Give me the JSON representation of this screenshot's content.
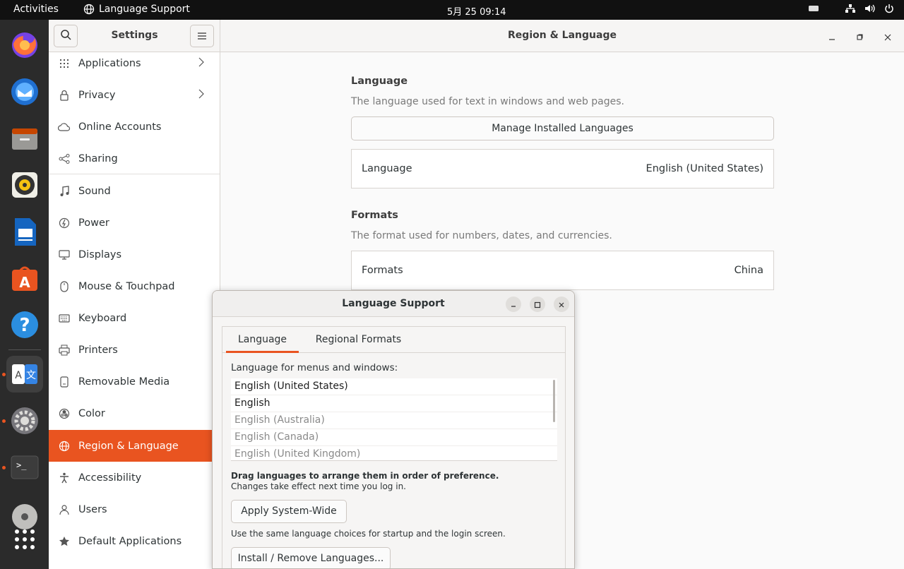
{
  "topbar": {
    "activities": "Activities",
    "app_name": "Language Support",
    "clock": "5月 25  09:14",
    "tray_icons": [
      "keyboard-icon",
      "network-icon",
      "volume-icon",
      "power-icon"
    ]
  },
  "dock": {
    "items": [
      "firefox",
      "thunderbird",
      "files",
      "rhythmbox",
      "libreoffice-writer",
      "ubuntu-software",
      "help",
      "language-support",
      "settings",
      "terminal",
      "disc",
      "show-apps"
    ]
  },
  "sidebar": {
    "title": "Settings",
    "items": [
      {
        "label": "Applications",
        "icon": "apps-grid-icon",
        "chevron": true
      },
      {
        "label": "Privacy",
        "icon": "lock-icon",
        "chevron": true
      },
      {
        "label": "Online Accounts",
        "icon": "cloud-icon",
        "chevron": false
      },
      {
        "label": "Sharing",
        "icon": "share-icon",
        "chevron": false
      },
      {
        "label": "Sound",
        "icon": "music-note-icon",
        "chevron": false
      },
      {
        "label": "Power",
        "icon": "power-icon",
        "chevron": false
      },
      {
        "label": "Displays",
        "icon": "display-icon",
        "chevron": false
      },
      {
        "label": "Mouse & Touchpad",
        "icon": "mouse-icon",
        "chevron": false
      },
      {
        "label": "Keyboard",
        "icon": "keyboard-icon",
        "chevron": false
      },
      {
        "label": "Printers",
        "icon": "printer-icon",
        "chevron": false
      },
      {
        "label": "Removable Media",
        "icon": "media-icon",
        "chevron": false
      },
      {
        "label": "Color",
        "icon": "color-icon",
        "chevron": false
      },
      {
        "label": "Region & Language",
        "icon": "globe-icon",
        "chevron": false,
        "selected": true
      },
      {
        "label": "Accessibility",
        "icon": "accessibility-icon",
        "chevron": false
      },
      {
        "label": "Users",
        "icon": "users-icon",
        "chevron": false
      },
      {
        "label": "Default Applications",
        "icon": "star-icon",
        "chevron": false
      }
    ]
  },
  "main": {
    "title": "Region & Language",
    "language_section": {
      "title": "Language",
      "description": "The language used for text in windows and web pages.",
      "manage_button": "Manage Installed Languages",
      "row_label": "Language",
      "row_value": "English (United States)"
    },
    "formats_section": {
      "title": "Formats",
      "description": "The format used for numbers, dates, and currencies.",
      "row_label": "Formats",
      "row_value": "China"
    }
  },
  "dialog": {
    "title": "Language Support",
    "tabs": [
      "Language",
      "Regional Formats"
    ],
    "active_tab": "Language",
    "menus_label": "Language for menus and windows:",
    "languages": [
      {
        "name": "English (United States)",
        "enabled": true
      },
      {
        "name": "English",
        "enabled": true
      },
      {
        "name": "English (Australia)",
        "enabled": false
      },
      {
        "name": "English (Canada)",
        "enabled": false
      },
      {
        "name": "English (United Kingdom)",
        "enabled": false
      }
    ],
    "drag_hint": "Drag languages to arrange them in order of preference.",
    "effect_hint": "Changes take effect next time you log in.",
    "apply_button": "Apply System-Wide",
    "apply_hint": "Use the same language choices for startup and the login screen.",
    "install_button": "Install / Remove Languages..."
  },
  "colors": {
    "accent": "#e95420",
    "dock": "#2b2b2b",
    "topbar": "#111111"
  }
}
